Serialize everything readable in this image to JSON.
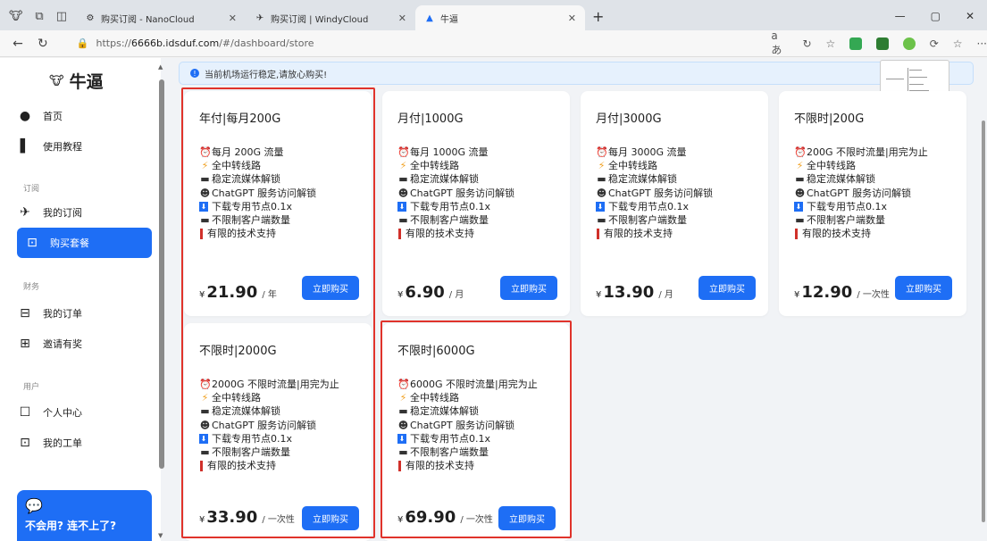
{
  "browser": {
    "tabs": [
      {
        "title": "购买订阅 - NanoCloud",
        "favicon": "gear-icon"
      },
      {
        "title": "购买订阅 | WindyCloud",
        "favicon": "plane-icon"
      },
      {
        "title": "牛逼",
        "favicon": "boat-icon"
      }
    ],
    "new_tab": "+",
    "url_prefix": "https://",
    "url_host": "6666b.idsduf.com",
    "url_path": "/#/dashboard/store"
  },
  "sidebar": {
    "logo_icon": "🐮",
    "logo_text": "牛逼",
    "items": [
      {
        "label": "首页",
        "icon": "●"
      },
      {
        "label": "使用教程",
        "icon": "▌"
      },
      {
        "label": "我的订阅",
        "icon": "✈"
      },
      {
        "label": "购买套餐",
        "icon": "⊡"
      },
      {
        "label": "我的订单",
        "icon": "⊟"
      },
      {
        "label": "邀请有奖",
        "icon": "⊞"
      },
      {
        "label": "个人中心",
        "icon": "☐"
      },
      {
        "label": "我的工单",
        "icon": "⊡"
      }
    ],
    "groups": [
      "订阅",
      "财务",
      "用户"
    ],
    "help_card": {
      "icon": "💬",
      "text": "不会用? 连不上了?"
    }
  },
  "notice": "当前机场运行稳定,请放心购买!",
  "buy_label": "立即购买",
  "currency": "¥",
  "plans": [
    {
      "title": "年付|每月200G",
      "features": [
        "每月 200G 流量",
        "全中转线路",
        "稳定流媒体解锁",
        "ChatGPT 服务访问解锁",
        "下载专用节点0.1x",
        "不限制客户端数量",
        "有限的技术支持"
      ],
      "price": "21.90",
      "unit": "/ 年"
    },
    {
      "title": "月付|1000G",
      "features": [
        "每月 1000G 流量",
        "全中转线路",
        "稳定流媒体解锁",
        "ChatGPT 服务访问解锁",
        "下载专用节点0.1x",
        "不限制客户端数量",
        "有限的技术支持"
      ],
      "price": "6.90",
      "unit": "/ 月"
    },
    {
      "title": "月付|3000G",
      "features": [
        "每月 3000G 流量",
        "全中转线路",
        "稳定流媒体解锁",
        "ChatGPT 服务访问解锁",
        "下载专用节点0.1x",
        "不限制客户端数量",
        "有限的技术支持"
      ],
      "price": "13.90",
      "unit": "/ 月"
    },
    {
      "title": "不限时|200G",
      "features": [
        "200G 不限时流量|用完为止",
        "全中转线路",
        "稳定流媒体解锁",
        "ChatGPT 服务访问解锁",
        "下载专用节点0.1x",
        "不限制客户端数量",
        "有限的技术支持"
      ],
      "price": "12.90",
      "unit": "/ 一次性"
    },
    {
      "title": "不限时|2000G",
      "features": [
        "2000G 不限时流量|用完为止",
        "全中转线路",
        "稳定流媒体解锁",
        "ChatGPT 服务访问解锁",
        "下载专用节点0.1x",
        "不限制客户端数量",
        "有限的技术支持"
      ],
      "price": "33.90",
      "unit": "/ 一次性"
    },
    {
      "title": "不限时|6000G",
      "features": [
        "6000G 不限时流量|用完为止",
        "全中转线路",
        "稳定流媒体解锁",
        "ChatGPT 服务访问解锁",
        "下载专用节点0.1x",
        "不限制客户端数量",
        "有限的技术支持"
      ],
      "price": "69.90",
      "unit": "/ 一次性"
    }
  ],
  "feature_icons": [
    "alarm-clock-icon",
    "lightning-icon",
    "screen-icon",
    "robot-icon",
    "download-icon",
    "laptop-icon",
    "red-bar-icon"
  ],
  "accent_color": "#1e6ef5",
  "highlight_color": "#e0332b"
}
